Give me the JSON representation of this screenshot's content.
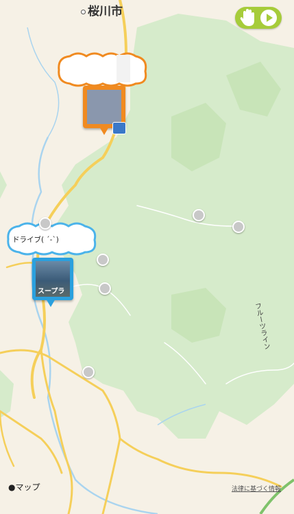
{
  "map": {
    "city_label": "桜川市",
    "road_label": "フルーツライン",
    "attribution": "マップ",
    "legal_link": "法律に基づく情報"
  },
  "pins": {
    "blue_pin_caption": "スープラ",
    "blue_cloud_text": "ドライブ( ´-`)"
  },
  "icons": {
    "hand": "hand-icon",
    "play": "play-icon",
    "apple": "apple-logo-icon"
  },
  "colors": {
    "forest": "#cfe7c5",
    "land": "#f6f1e6",
    "road": "#f5cf5a",
    "water": "#a9d4ef",
    "control_green": "#a6cc3a",
    "pin_orange": "#f08a20",
    "pin_blue": "#2aa0de"
  }
}
